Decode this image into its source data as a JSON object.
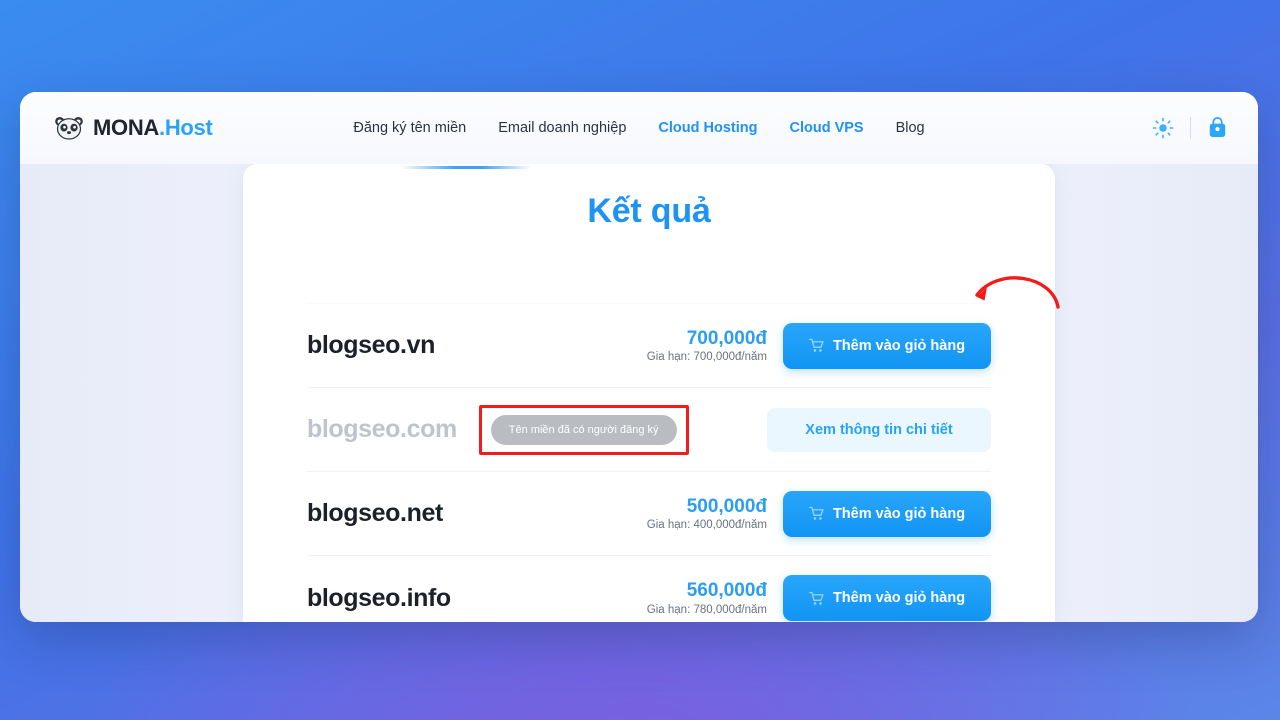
{
  "header": {
    "brand_main": "MONA",
    "brand_suffix": ".Host",
    "logo_icon": "panda-icon",
    "nav": [
      {
        "label": "Đăng ký tên miền",
        "accent": false
      },
      {
        "label": "Email doanh nghiệp",
        "accent": false
      },
      {
        "label": "Cloud Hosting",
        "accent": true
      },
      {
        "label": "Cloud VPS",
        "accent": true
      },
      {
        "label": "Blog",
        "accent": false
      }
    ],
    "actions": {
      "theme_icon": "sun-icon",
      "cart_icon": "shopping-bag-icon"
    }
  },
  "main": {
    "title": "Kết quả",
    "rows": [
      {
        "domain": "blogseo.vn",
        "available": true,
        "price": "700,000đ",
        "renew": "Gia hạn: 700,000đ/năm",
        "button": "Thêm vào giỏ hàng",
        "button_icon": "cart-icon"
      },
      {
        "domain": "blogseo.com",
        "available": false,
        "badge": "Tên miền đã có người đăng ký",
        "button": "Xem thông tin chi tiết"
      },
      {
        "domain": "blogseo.net",
        "available": true,
        "price": "500,000đ",
        "renew": "Gia hạn: 400,000đ/năm",
        "button": "Thêm vào giỏ hàng",
        "button_icon": "cart-icon"
      },
      {
        "domain": "blogseo.info",
        "available": true,
        "price": "560,000đ",
        "renew": "Gia hạn: 780,000đ/năm",
        "button": "Thêm vào giỏ hàng",
        "button_icon": "cart-icon"
      }
    ]
  },
  "annotations": {
    "arrow_color": "#f41b1b",
    "highlight_color": "#f41b1b",
    "arrow_target": "Thêm vào giỏ hàng (blogseo.vn)"
  },
  "colors": {
    "accent_blue": "#1f93f4",
    "price_blue": "#2b9ef2",
    "button_blue": "#1194f3",
    "badge_grey": "#b9bdc2",
    "backdrop_blue": "#3a8cf0",
    "backdrop_purple": "#7b5fe0"
  }
}
